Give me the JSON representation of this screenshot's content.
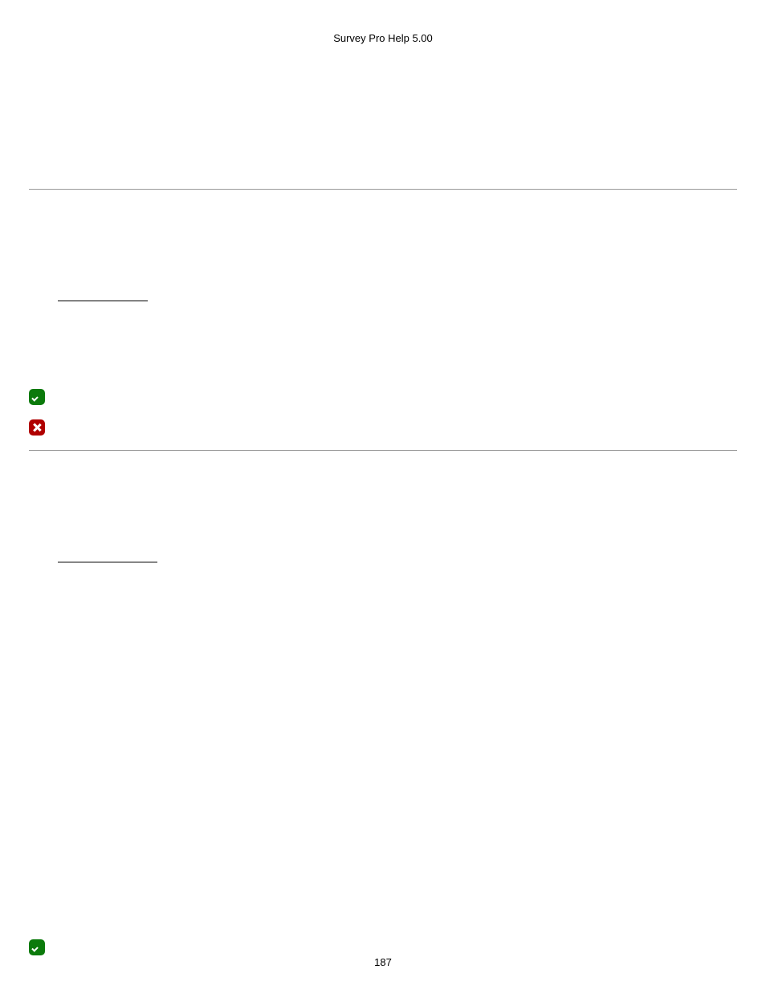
{
  "header": {
    "title": "Survey Pro Help 5.00"
  },
  "sections": {
    "first_underline_label": "",
    "second_underline_label": ""
  },
  "icons": {
    "check": "checkmark-icon",
    "cross": "cross-icon"
  },
  "footer": {
    "page_number": "187"
  }
}
